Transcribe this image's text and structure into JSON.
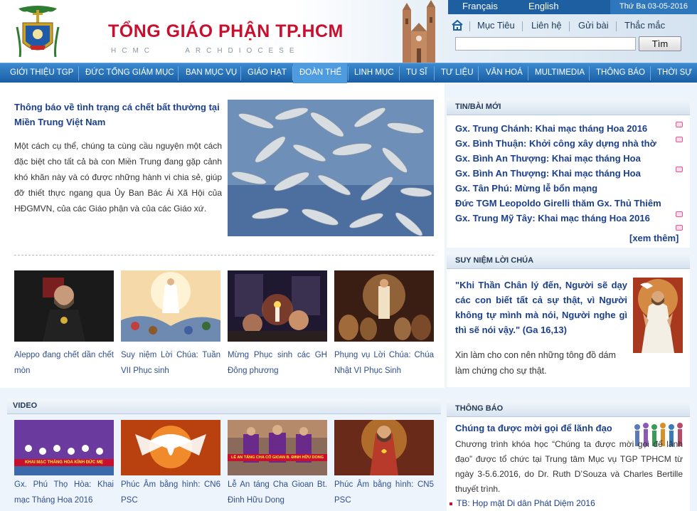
{
  "header": {
    "title": "TỔNG GIÁO PHẬN TP.HCM",
    "subtitle": "HCMC ARCHDIOCESE",
    "languages": [
      "Français",
      "English"
    ],
    "date": "Thứ Ba 03-05-2016",
    "links": [
      "Mục Tiêu",
      "Liên hệ",
      "Gửi bài",
      "Thắc mắc"
    ],
    "search": {
      "value": "",
      "button": "Tìm"
    }
  },
  "nav": {
    "items": [
      "GIỚI THIỆU TGP",
      "ĐỨC TỔNG GIÁM MỤC",
      "BAN MỤC VỤ",
      "GIÁO HẠT",
      "ĐOÀN THỂ",
      "LINH MỤC",
      "TU SĨ",
      "TƯ LIỆU",
      "VĂN HOÁ",
      "MULTIMEDIA",
      "THÔNG BÁO",
      "THỜI SỰ"
    ],
    "active": "ĐOÀN THỂ"
  },
  "hero": {
    "title": "Thông báo về tình trạng cá chết bất thường tại Miền Trung Việt Nam",
    "text": "Một cách cụ thể, chúng ta cùng cầu nguyện một cách đặc biệt cho tất cả bà con Miền Trung đang gặp cảnh khó khăn này và có được những hành vi chia sẻ, giúp đỡ thiết thực ngang qua Ủy Ban Bác Ái Xã Hội của HĐGMVN, của các Giáo phận và của các Giáo xứ."
  },
  "features": [
    {
      "caption": "Aleppo đang chết dần chết mòn"
    },
    {
      "caption": "Suy niệm Lời Chúa: Tuần VII Phục sinh"
    },
    {
      "caption": "Mừng Phục sinh các GH Đông phương"
    },
    {
      "caption": "Phụng vụ Lời Chúa: Chúa Nhật VI Phục Sinh"
    }
  ],
  "video": {
    "heading": "VIDEO",
    "items": [
      {
        "caption": "Gx. Phú Thọ Hòa: Khai mạc Tháng Hoa 2016",
        "overlay": "KHAI MẠC THÁNG HOA KÍNH ĐỨC MẸ"
      },
      {
        "caption": "Phúc Âm bằng hình: CN6 PSC",
        "overlay": ""
      },
      {
        "caption": "Lễ An táng Cha Gioan Bt. Đinh Hữu Dong",
        "overlay": "LỄ AN TÁNG CHA CỐ GIOAN B. ĐINH HỮU DONG"
      },
      {
        "caption": "Phúc Âm bằng hình: CN5 PSC",
        "overlay": ""
      }
    ]
  },
  "sidebar": {
    "news_heading": "TIN/BÀI MỚI",
    "news": [
      "Gx. Trung Chánh: Khai mạc tháng Hoa 2016",
      "Gx. Bình Thuận: Khởi công xây dựng nhà thờ",
      "Gx. Bình An Thượng: Khai mạc tháng Hoa",
      "Gx. Bình An Thượng: Khai mạc tháng Hoa",
      "Gx. Tân Phú: Mừng lễ bổn mạng",
      "Đức TGM Leopoldo Girelli thăm Gx. Thủ Thiêm",
      "Gx. Trung Mỹ Tây: Khai mạc tháng Hoa 2016"
    ],
    "see_more": "[xem thêm]",
    "reflection_heading": "SUY NIỆM LỜI CHÚA",
    "quote": "\"Khi Thần Chân lý đến, Người sẽ dạy các con biết tất cả sự thật, vì Người không tự mình mà nói, Người nghe gì thì sẽ nói vậy.\"",
    "quote_ref": "(Ga 16,13)",
    "prayer": "Xin làm cho con nên những tông đồ dám làm chứng cho sự thật.",
    "notice_heading": "THÔNG BÁO",
    "notice_title": "Chúng ta được mời gọi để lãnh đạo",
    "notice_text": "Chương trình khóa học “Chúng ta được mời gọi để lãnh đạo” được tổ chức tại Trung tâm Mục vụ TGP TPHCM từ ngày 3-5.6.2016, do Dr. Ruth D’Souza và Charles Bertille thuyết trình.",
    "notice_link": "TB: Họp mặt Di dân Phát Diệm 2016"
  }
}
